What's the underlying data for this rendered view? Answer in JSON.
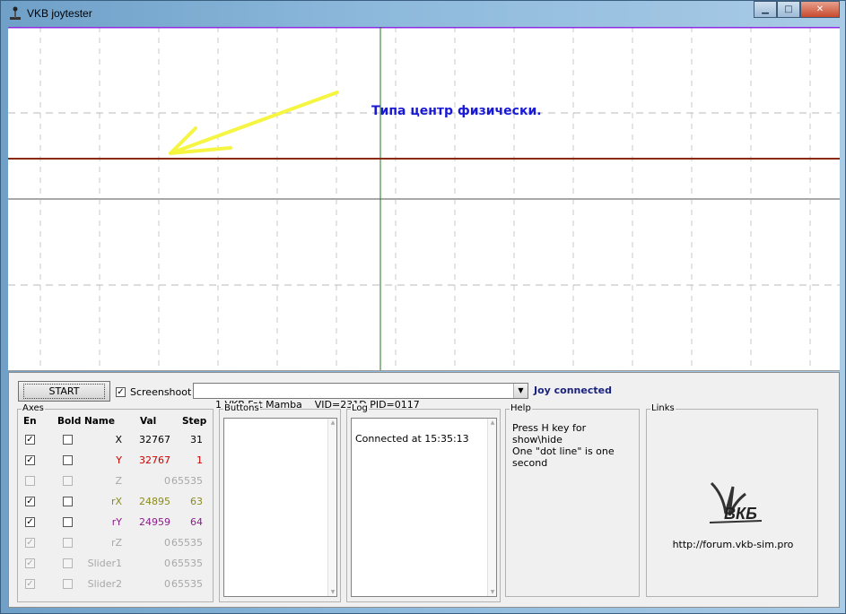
{
  "window": {
    "title": "VKB joytester",
    "buttons": {
      "minimize": "▁",
      "maximize": "□",
      "close": "✕"
    }
  },
  "plot": {
    "annotation": "Типа центр физически.",
    "annotation_color": "#1a1ad6",
    "arrow_color": "#f5f542",
    "center_line_color": "#1c7a1c",
    "trace_color": "#8a2a0a",
    "top_line_color": "#8a2be2"
  },
  "controls": {
    "start_label": "START",
    "screenshoot_label": "Screenshoot",
    "screenshoot_checked": true,
    "device": "1 VKB Fat Mamba    VID=231D PID=0117",
    "status": "Joy connected"
  },
  "axes": {
    "group_label": "Axes",
    "headers": {
      "en": "En",
      "bold": "Bold",
      "name": "Name",
      "val": "Val",
      "step": "Step"
    },
    "rows": [
      {
        "name": "X",
        "val": "32767",
        "step": "31",
        "enabled": true,
        "disabled": false,
        "color": "#000000"
      },
      {
        "name": "Y",
        "val": "32767",
        "step": "1",
        "enabled": true,
        "disabled": false,
        "color": "#cc0000"
      },
      {
        "name": "Z",
        "val": "0",
        "step": "65535",
        "enabled": false,
        "disabled": true,
        "color": "#a8a8a8"
      },
      {
        "name": "rX",
        "val": "24895",
        "step": "63",
        "enabled": true,
        "disabled": false,
        "color": "#8a8a1e"
      },
      {
        "name": "rY",
        "val": "24959",
        "step": "64",
        "enabled": true,
        "disabled": false,
        "color": "#8a1e8a"
      },
      {
        "name": "rZ",
        "val": "0",
        "step": "65535",
        "enabled": true,
        "disabled": true,
        "color": "#a8a8a8"
      },
      {
        "name": "Slider1",
        "val": "0",
        "step": "65535",
        "enabled": true,
        "disabled": true,
        "color": "#a8a8a8"
      },
      {
        "name": "Slider2",
        "val": "0",
        "step": "65535",
        "enabled": true,
        "disabled": true,
        "color": "#a8a8a8"
      }
    ]
  },
  "buttons_group": {
    "label": "Buttons"
  },
  "log": {
    "label": "Log",
    "lines": [
      "Connected at 15:35:13"
    ]
  },
  "help": {
    "label": "Help",
    "lines": [
      "Press H key for show\\hide",
      "One \"dot line\" is one second"
    ]
  },
  "links": {
    "label": "Links",
    "url": "http://forum.vkb-sim.pro",
    "logo_text": "ВКБ"
  }
}
